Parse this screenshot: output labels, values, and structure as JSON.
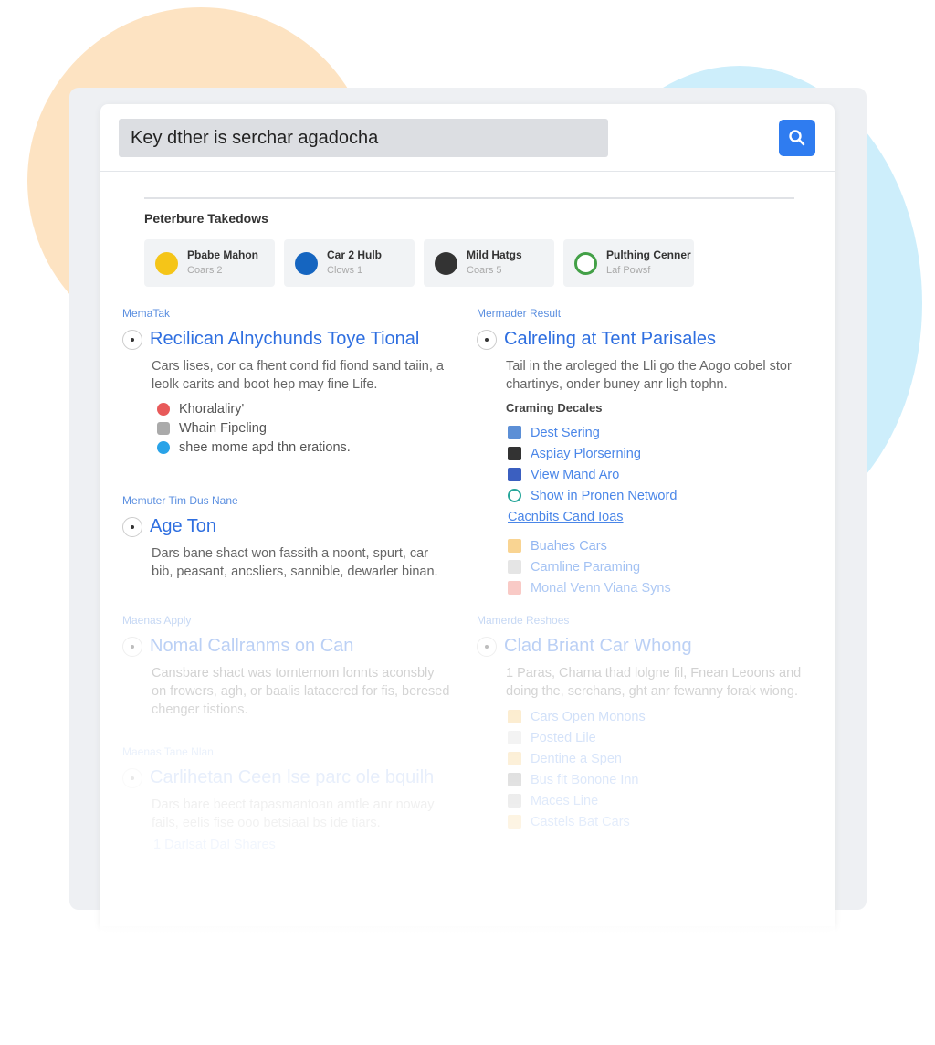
{
  "search": {
    "value": "Key dther is serchar agadocha",
    "icon": "search-icon",
    "accent": "#2f7cf0"
  },
  "section_title": "Peterbure Takedows",
  "cards": [
    {
      "title": "Pbabe Mahon",
      "sub": "Coars 2",
      "color": "#f5c518"
    },
    {
      "title": "Car 2 Hulb",
      "sub": "Clows 1",
      "color": "#1565c0"
    },
    {
      "title": "Mild Hatgs",
      "sub": "Coars 5",
      "color": "#333333"
    },
    {
      "title": "Pulthing Cenner",
      "sub": "Laf Powsf",
      "color": "#43a047"
    }
  ],
  "left": [
    {
      "label": "MemaTak",
      "title": "Recilican Alnychunds Toye Tional",
      "desc": "Cars lises, cor ca fhent cond fid fiond sand taiin, a leolk carits and boot hep may fine Life.",
      "items": [
        {
          "text": "Khoralaliry'",
          "color": "#e85a5a"
        },
        {
          "text": "Whain Fipeling",
          "color": "#aaaaaa"
        },
        {
          "text": "shee mome apd thn erations.",
          "color": "#29a3e8"
        }
      ]
    },
    {
      "label": "Memuter Tim Dus Nane",
      "title": "Age Ton",
      "desc": "Dars bane shact won fassith a noont, spurt, car bib, peasant, ancsliers, sannible, dewarler binan."
    },
    {
      "label": "Maenas Apply",
      "title": "Nomal Callranms on Can",
      "desc": "Cansbare shact was tornternom lonnts aconsbly on frowers, agh, or baalis latacered for fis, beresed chenger tistions."
    },
    {
      "label": "Maenas Tane Nlan",
      "title": "Carlihetan Ceen lse parc ole bquilh",
      "desc": "Dars bare beect tapasmantoan amtle anr noway fails, eelis fise ooo betsiaal bs ide tiars.",
      "link": "1 Darlsat Dal Shares"
    }
  ],
  "right": [
    {
      "label": "Mermader Result",
      "title": "Calreling at Tent Parisales",
      "desc": "Tail in the aroleged the Lli go the Aogo cobel stor chartinys, onder buney anr ligh tophn.",
      "subhead": "Craming Decales",
      "links": [
        {
          "text": "Dest Sering",
          "color": "#5c8fd6"
        },
        {
          "text": "Aspiay Plorserning",
          "color": "#333333"
        },
        {
          "text": "View Mand Aro",
          "color": "#3b5fc0"
        },
        {
          "text": "Show in Pronen Netword",
          "color": "#26a69a"
        }
      ],
      "more_link": "Cacnbits Cand Ioas",
      "links2": [
        {
          "text": "Buahes Cars",
          "color": "#f6b84a"
        },
        {
          "text": "Carnline Paraming",
          "color": "#cccccc"
        },
        {
          "text": "Monal Venn Viana Syns",
          "color": "#f28b82"
        }
      ]
    },
    {
      "label": "Mamerde Reshoes",
      "title": "Clad Briant Car Whong",
      "desc": "1 Paras, Chama thad lolgne fil, Fnean Leoons and doing the, serchans, ght anr fewanny forak wiong.",
      "links": [
        {
          "text": "Cars Open Monons",
          "color": "#f6b84a"
        },
        {
          "text": "Posted Lile",
          "color": "#cccccc"
        },
        {
          "text": "Dentine a Spen",
          "color": "#f6b84a"
        },
        {
          "text": "Bus fit Bonone Inn",
          "color": "#666666"
        },
        {
          "text": "Maces Line",
          "color": "#999999"
        },
        {
          "text": "Castels Bat Cars",
          "color": "#f6b84a"
        }
      ]
    }
  ]
}
